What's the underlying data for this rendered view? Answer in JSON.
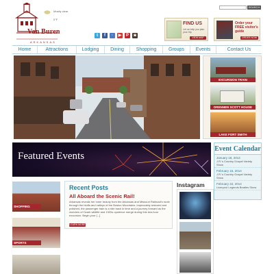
{
  "header": {
    "logo_text": "Van Buren",
    "logo_sub": "ARKANSAS",
    "weather_text": "Mostly clear",
    "weather_temp": "0°F",
    "search_label": "SEARCH",
    "findus": {
      "title": "FIND US",
      "body": "Let us help you plan your trip",
      "button": "VIEW MAP"
    },
    "guide": {
      "title": "Order your FREE visitor's guide",
      "button": "ORDER NOW"
    }
  },
  "nav": {
    "items": [
      "Home",
      "Attractions",
      "Lodging",
      "Dining",
      "Shopping",
      "Groups",
      "Events",
      "Contact Us"
    ]
  },
  "hero_side": {
    "items": [
      "EXCURSION TRAIN",
      "DRENNEN SCOTT HOUSE",
      "LAKE FORT SMITH"
    ]
  },
  "featured": {
    "title": "Featured Events"
  },
  "calendar": {
    "title": "Event Calendar",
    "events": [
      {
        "date": "January 18, 2014",
        "name": "J.R.'s Country Gospel Variety Show"
      },
      {
        "date": "February 15, 2014",
        "name": "J.R.'s Country Gospel Variety Show"
      },
      {
        "date": "February 22, 2014",
        "name": "Liverpool Legends Beatles Show"
      }
    ]
  },
  "categories": [
    "SHOPPING",
    "SPORTS"
  ],
  "posts": {
    "heading": "Recent Posts",
    "title": "All Aboard the Scenic Rail!",
    "body": "Arkansas reveals her inner beauty from the Arkansas and Missouri Railroad's route through the bluffs and valleys of the Boston Mountains. Impeccably restored and polished, the passenger train is a ride back in time and a journey forward as the wonders of Ozark wildlife and 1920s opulence merge during this two-hour excursion.  Begin your [...]",
    "button": "LEARN MORE"
  },
  "instagram": {
    "heading": "Instagram"
  },
  "colors": {
    "brand_red": "#a5262d",
    "nav_blue": "#2a7c98"
  }
}
